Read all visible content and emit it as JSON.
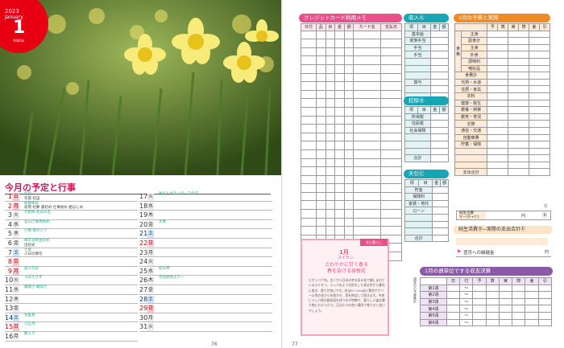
{
  "calendar": {
    "year": "2023",
    "month_en": "January",
    "day": "1",
    "era": "令和5年"
  },
  "schedule": {
    "title": "今月の予定と行事",
    "left_days": [
      {
        "d": "1",
        "w": "日",
        "type": "sun",
        "t": "元旦",
        "t2": "年賀 初詣"
      },
      {
        "d": "2",
        "w": "月",
        "type": "sun",
        "t": "振替休日",
        "t2": "初荷 初夢 書初め 仕事始め 姫はじめ"
      },
      {
        "d": "3",
        "w": "火",
        "type": "",
        "t": "元始祭 初日の出",
        "t2": ""
      },
      {
        "d": "4",
        "w": "水",
        "type": "",
        "t": "官公庁御用始め",
        "t2": ""
      },
      {
        "d": "5",
        "w": "木",
        "type": "",
        "t": "小寒 寒の入り",
        "t2": ""
      },
      {
        "d": "6",
        "w": "金",
        "type": "",
        "t": "東京消防出初式",
        "t2": "出初式"
      },
      {
        "d": "7",
        "w": "土",
        "type": "sat",
        "t": "七草",
        "t2": "人日の節句"
      },
      {
        "d": "8",
        "w": "日",
        "type": "sun",
        "t": "",
        "t2": ""
      },
      {
        "d": "9",
        "w": "月",
        "type": "sun",
        "t": "成人の日",
        "t2": ""
      },
      {
        "d": "10",
        "w": "火",
        "type": "",
        "t": "十日えびす",
        "t2": ""
      },
      {
        "d": "11",
        "w": "水",
        "type": "",
        "t": "鏡開き 蔵開き",
        "t2": ""
      },
      {
        "d": "12",
        "w": "木",
        "type": "",
        "t": "",
        "t2": ""
      },
      {
        "d": "13",
        "w": "金",
        "type": "",
        "t": "",
        "t2": ""
      },
      {
        "d": "14",
        "w": "土",
        "type": "sat",
        "t": "左義長",
        "t2": ""
      },
      {
        "d": "15",
        "w": "日",
        "type": "sun",
        "t": "小正月",
        "t2": ""
      },
      {
        "d": "16",
        "w": "月",
        "type": "",
        "t": "藪入り",
        "t2": ""
      }
    ],
    "right_days": [
      {
        "d": "17",
        "w": "火",
        "type": "",
        "t": "防災とボランティアの日",
        "t2": ""
      },
      {
        "d": "18",
        "w": "水",
        "type": "",
        "t": "",
        "t2": ""
      },
      {
        "d": "19",
        "w": "木",
        "type": "",
        "t": "",
        "t2": ""
      },
      {
        "d": "20",
        "w": "金",
        "type": "",
        "t": "大寒",
        "t2": ""
      },
      {
        "d": "21",
        "w": "土",
        "type": "sat",
        "t": "",
        "t2": ""
      },
      {
        "d": "22",
        "w": "日",
        "type": "sun",
        "t": "",
        "t2": ""
      },
      {
        "d": "23",
        "w": "月",
        "type": "",
        "t": "",
        "t2": ""
      },
      {
        "d": "24",
        "w": "火",
        "type": "",
        "t": "",
        "t2": ""
      },
      {
        "d": "25",
        "w": "水",
        "type": "",
        "t": "初天神",
        "t2": ""
      },
      {
        "d": "26",
        "w": "木",
        "type": "",
        "t": "文化財防火デー",
        "t2": ""
      },
      {
        "d": "27",
        "w": "金",
        "type": "",
        "t": "",
        "t2": ""
      },
      {
        "d": "28",
        "w": "土",
        "type": "sat",
        "t": "",
        "t2": ""
      },
      {
        "d": "29",
        "w": "日",
        "type": "sun",
        "t": "",
        "t2": ""
      },
      {
        "d": "30",
        "w": "月",
        "type": "",
        "t": "",
        "t2": ""
      },
      {
        "d": "31",
        "w": "火",
        "type": "",
        "t": "",
        "t2": ""
      }
    ]
  },
  "page_left": "76",
  "page_right": "77",
  "credit": {
    "title": "クレジットカード利用メモ",
    "cols": [
      "日付",
      "品",
      "目",
      "金",
      "額",
      "カード名",
      "支払日"
    ]
  },
  "income": {
    "title": "収入Ⓐ",
    "cols": [
      "項",
      "目",
      "金",
      "額"
    ],
    "rows": [
      "基本給",
      "家族手当",
      "手当",
      "手当",
      "",
      "",
      "",
      "賞与",
      "",
      "",
      "雑収入"
    ],
    "total": "合計"
  },
  "deduct": {
    "title": "控除Ⓑ",
    "cols": [
      "項",
      "目",
      "金",
      "額"
    ],
    "rows": [
      "所得税",
      "住民税",
      "社会保険",
      "",
      "",
      ""
    ],
    "total": "合計"
  },
  "tenbiki": {
    "title": "天引Ⓒ",
    "cols": [
      "項",
      "目",
      "金",
      "額"
    ],
    "rows": [
      "貯金",
      "保険料",
      "家賃・地代",
      "ローン",
      "",
      "",
      ""
    ],
    "total": "合計"
  },
  "budget": {
    "title": "1月の予算と実際",
    "cols": [
      "予",
      "算",
      "実",
      "際",
      "差",
      "引"
    ],
    "food_label": "食",
    "food_sub": "費",
    "rows": [
      "主食",
      "副食計",
      "主食",
      "外食",
      "調味料",
      "嗜好品",
      "食費計",
      "光熱・水道",
      "住居・家具",
      "衣料",
      "健康・衛生",
      "教養・娯楽",
      "教育・育児",
      "交際",
      "通信・交通",
      "自動車費",
      "貯蓄・保険",
      "",
      "",
      ""
    ],
    "total": "支出合計"
  },
  "calc": {
    "e": "Ⓔ",
    "net_label": "純生活費",
    "net_formula": "Ⓐ−(Ⓑ+Ⓒ)",
    "yen": "円",
    "d": "Ⓓ",
    "net_title": "純生活費Ⓓ−実際の支出合計Ⓔ",
    "carry_label": "翌月への繰越金",
    "carry_yen": "円"
  },
  "note": {
    "tag": "花と暮らし",
    "title": "1月",
    "subtitle": "スイセン",
    "headline1": "さわやかに甘く香る",
    "headline2": "春を告げる球根花",
    "body": "ヒガンバナ科。古くから日本の冬を彩る花で親しまれているスイセン。ラッパのような形をした花は冬から春先に咲き、香りが良いです。花は5〜7cmほど黄色やクリーム色の花びらを咲かせ、茎を伸ばして咲きます。中央にラッパ状の副花冠を持つのが特徴で、愛らしい姿は贈り物にもぴったり。日当たりの良い場所で育てると良いでしょう。"
  },
  "weekly": {
    "title": "1月の週単位でする収支決算",
    "cols": [
      "日",
      "付",
      "予",
      "算",
      "実",
      "際",
      "差",
      "引"
    ],
    "weeks": [
      "第1週",
      "第2週",
      "第3週",
      "第4週",
      "第5週",
      "第6週"
    ],
    "row_mark": "〜",
    "side": "週単位の予算集計"
  },
  "colors": {
    "pink": "#e9508a",
    "teal": "#19a6b4",
    "orange": "#f08a24",
    "purple": "#8a5aa8",
    "red": "#e60012"
  }
}
